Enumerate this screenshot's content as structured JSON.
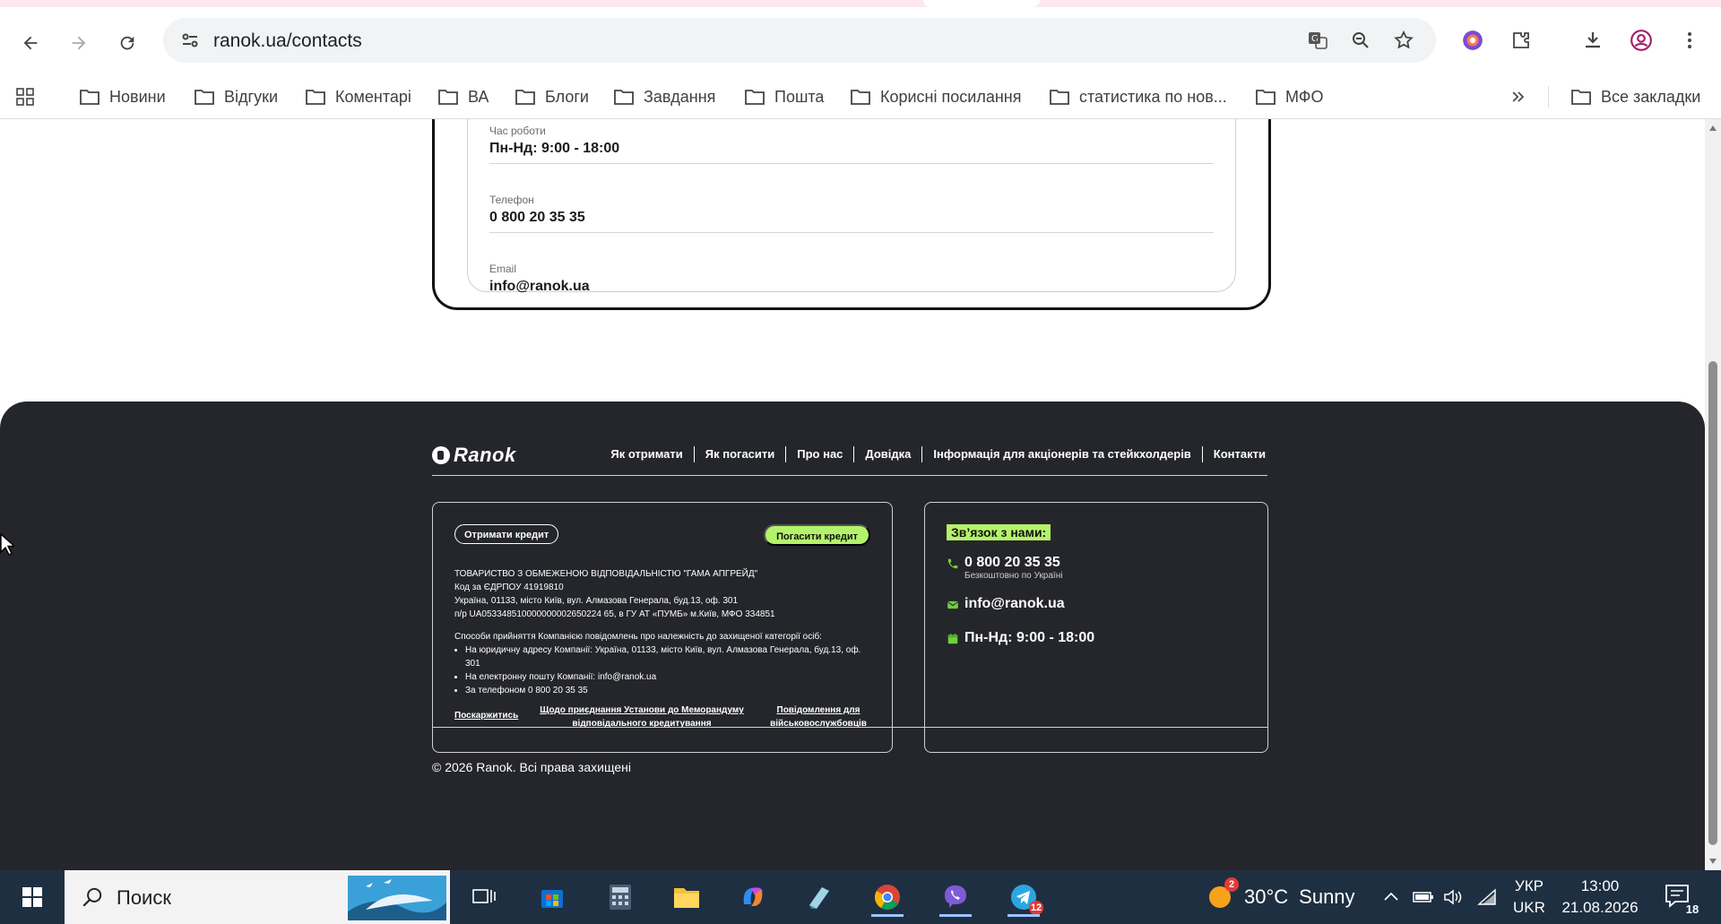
{
  "browser": {
    "url": "ranok.ua/contacts",
    "bookmarks": [
      "Новини",
      "Відгуки",
      "Коментарі",
      "ВА",
      "Блоги",
      "Завдання",
      "Пошта",
      "Корисні посилання",
      "статистика по нов...",
      "МФО"
    ],
    "all_bookmarks_label": "Все закладки"
  },
  "contact_card": {
    "hours_label": "Час роботи",
    "hours_value": "Пн-Нд: 9:00 - 18:00",
    "phone_label": "Телефон",
    "phone_value": "0 800 20 35 35",
    "email_label": "Email",
    "email_value": "info@ranok.ua"
  },
  "footer": {
    "logo_text": "Ranok",
    "nav": [
      "Як отримати",
      "Як погасити",
      "Про нас",
      "Довідка",
      "Інформація для акціонерів та стейкхолдерів",
      "Контакти"
    ],
    "get_credit_button": "Отримати кредит",
    "repay_credit_button": "Погасити кредит",
    "company_lines": [
      "ТОВАРИСТВО З ОБМЕЖЕНОЮ ВІДПОВІДАЛЬНІСТЮ \"ГАМА АПГРЕЙД\"",
      "Код за ЄДРПОУ 41919810",
      "Україна, 01133, місто Київ, вул. Алмазова Генерала, буд.13, оф. 301",
      "п/р UA053348510000000002650224 65, в ГУ АТ «ПУМБ» м.Київ, МФО 334851"
    ],
    "notice_intro": "Способи прийняття Компанією повідомлень про належність до захищеної категорії осіб:",
    "notice_items": [
      "На юридичну адресу Компанії: Україна, 01133, місто Київ, вул. Алмазова Генерала, буд.13, оф. 301",
      "На електронну пошту Компанії: info@ranok.ua",
      "За телефоном 0 800 20 35 35"
    ],
    "link_complain": "Поскаржитись",
    "link_memorandum": "Щодо приєднання Установи до Меморандуму відповідального кредитування",
    "link_military": "Повідомлення для військовослужбовців",
    "contact_title": "Зв’язок з нами:",
    "contact_phone": "0 800 20 35 35",
    "contact_phone_note": "Безкоштовно по Україні",
    "contact_email": "info@ranok.ua",
    "contact_hours": "Пн-Нд: 9:00 - 18:00",
    "copyright": "© 2026 Ranok. Всі права захищені"
  },
  "taskbar": {
    "search_placeholder": "Поиск",
    "weather_temp": "30°C",
    "weather_desc": "Sunny",
    "weather_badge": "2",
    "telegram_badge": "12",
    "lang_top": "УКР",
    "lang_bottom": "UKR",
    "time": "13:00",
    "date": "21.08.2026",
    "notification_count": "18"
  }
}
